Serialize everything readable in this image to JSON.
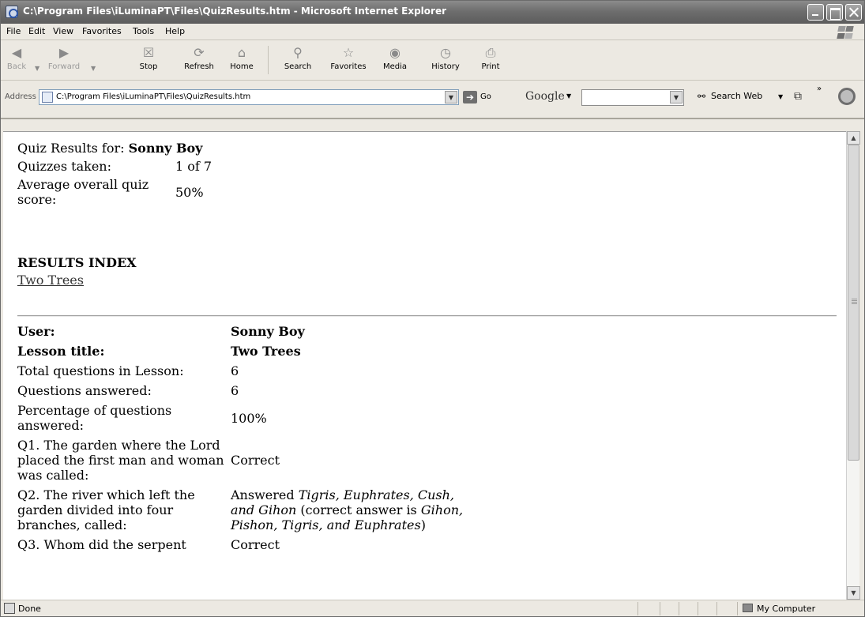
{
  "window": {
    "title": "C:\\Program Files\\iLuminaPT\\Files\\QuizResults.htm - Microsoft Internet Explorer"
  },
  "menu": [
    "File",
    "Edit",
    "View",
    "Favorites",
    "Tools",
    "Help"
  ],
  "toolbar": {
    "back": "Back",
    "forward": "Forward",
    "stop": "Stop",
    "refresh": "Refresh",
    "home": "Home",
    "search": "Search",
    "favorites": "Favorites",
    "media": "Media",
    "history": "History",
    "print": "Print"
  },
  "address": {
    "label": "Address",
    "value": "C:\\Program Files\\iLuminaPT\\Files\\QuizResults.htm",
    "go": "Go"
  },
  "google": {
    "logo": "Google",
    "search_web": "Search Web"
  },
  "page": {
    "results_for_label": "Quiz Results for:",
    "user_name": "Sonny Boy",
    "quizzes_taken_label": "Quizzes taken:",
    "quizzes_taken_value": "1 of 7",
    "average_label": "Average overall quiz score:",
    "average_value": "50%",
    "results_index_heading": "RESULTS INDEX",
    "index_link": "Two Trees",
    "detail": {
      "user_label": "User:",
      "user_value": "Sonny Boy",
      "lesson_label": "Lesson title:",
      "lesson_value": "Two Trees",
      "total_label": "Total questions in Lesson:",
      "total_value": "6",
      "answered_label": "Questions answered:",
      "answered_value": "6",
      "percent_label": "Percentage of questions answered:",
      "percent_value": "100%",
      "q1_label": "Q1. The garden where the Lord placed the first man and woman was called:",
      "q1_value": "Correct",
      "q2_label": "Q2. The river which left the garden divided into four branches, called:",
      "q2_answered_prefix": "Answered",
      "q2_answered": "Tigris, Euphrates, Cush, and Gihon",
      "q2_correct_prefix": "(correct answer is",
      "q2_correct": "Gihon, Pishon, Tigris, and Euphrates",
      "q2_close": ")",
      "q3_label": "Q3. Whom did the serpent",
      "q3_value": "Correct"
    }
  },
  "status": {
    "text": "Done",
    "zone": "My Computer"
  }
}
